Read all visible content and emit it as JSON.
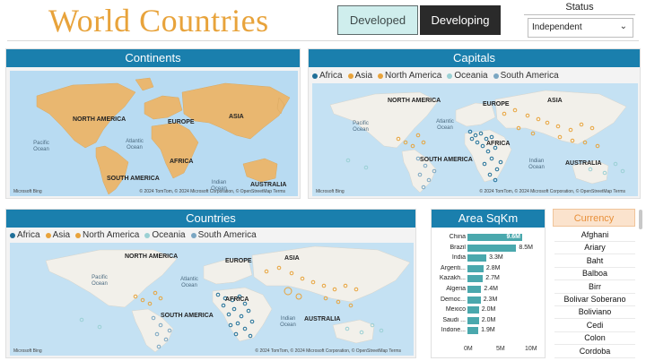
{
  "header": {
    "title": "World Countries",
    "buttons": {
      "developed": "Developed",
      "developing": "Developing"
    },
    "status": {
      "label": "Status",
      "value": "Independent"
    }
  },
  "continents_panel": {
    "title": "Continents",
    "map_labels": [
      "NORTH AMERICA",
      "EUROPE",
      "ASIA",
      "AFRICA",
      "SOUTH AMERICA",
      "AUSTRALIA"
    ],
    "ocean_labels": [
      "Pacific Ocean",
      "Atlantic Ocean",
      "Indian Ocean"
    ],
    "credit": "© 2024 TomTom, © 2024 Microsoft Corporation, © OpenStreetMap  Terms",
    "bing": "Microsoft Bing"
  },
  "capitals_panel": {
    "title": "Capitals",
    "legend": [
      "Africa",
      "Asia",
      "North America",
      "Oceania",
      "South America"
    ],
    "map_labels": [
      "NORTH AMERICA",
      "EUROPE",
      "ASIA",
      "AFRICA",
      "SOUTH AMERICA",
      "AUSTRALIA"
    ],
    "ocean_labels": [
      "Pacific Ocean",
      "Atlantic Ocean",
      "Indian Ocean"
    ],
    "credit": "© 2024 TomTom, © 2024 Microsoft Corporation, © OpenStreetMap  Terms",
    "bing": "Microsoft Bing"
  },
  "countries_panel": {
    "title": "Countries",
    "legend": [
      "Africa",
      "Asia",
      "North America",
      "Oceania",
      "South America"
    ],
    "map_labels": [
      "NORTH AMERICA",
      "EUROPE",
      "ASIA",
      "AFRICA",
      "SOUTH AMERICA",
      "AUSTRALIA"
    ],
    "ocean_labels": [
      "Pacific Ocean",
      "Atlantic Ocean",
      "Indian Ocean"
    ],
    "credit": "© 2024 TomTom, © 2024 Microsoft Corporation, © OpenStreetMap  Terms",
    "bing": "Microsoft Bing"
  },
  "legend_colors": {
    "Africa": "#1f6f98",
    "Asia": "#e8a33b",
    "North America": "#e8a33b",
    "Oceania": "#9ad0d4",
    "South America": "#7aa6c2"
  },
  "area_panel": {
    "title": "Area SqKm",
    "x_ticks": [
      "0M",
      "5M",
      "10M"
    ]
  },
  "chart_data": {
    "type": "bar",
    "title": "Area SqKm",
    "categories": [
      "China",
      "Brazil",
      "India",
      "Argenti...",
      "Kazakh...",
      "Algeria",
      "Democ...",
      "Mexico",
      "Saudi ...",
      "Indone..."
    ],
    "values": [
      9.6,
      8.5,
      3.3,
      2.8,
      2.7,
      2.4,
      2.3,
      2.0,
      2.0,
      1.9
    ],
    "value_labels": [
      "9.6M",
      "8.5M",
      "3.3M",
      "2.8M",
      "2.7M",
      "2.4M",
      "2.3M",
      "2.0M",
      "2.0M",
      "1.9M"
    ],
    "xlim": [
      0,
      10
    ],
    "color": "#4aa8ad"
  },
  "currency": {
    "title": "Currency",
    "items": [
      "Afghani",
      "Ariary",
      "Baht",
      "Balboa",
      "Birr",
      "Bolivar Soberano",
      "Boliviano",
      "Cedi",
      "Colon",
      "Cordoba"
    ]
  }
}
